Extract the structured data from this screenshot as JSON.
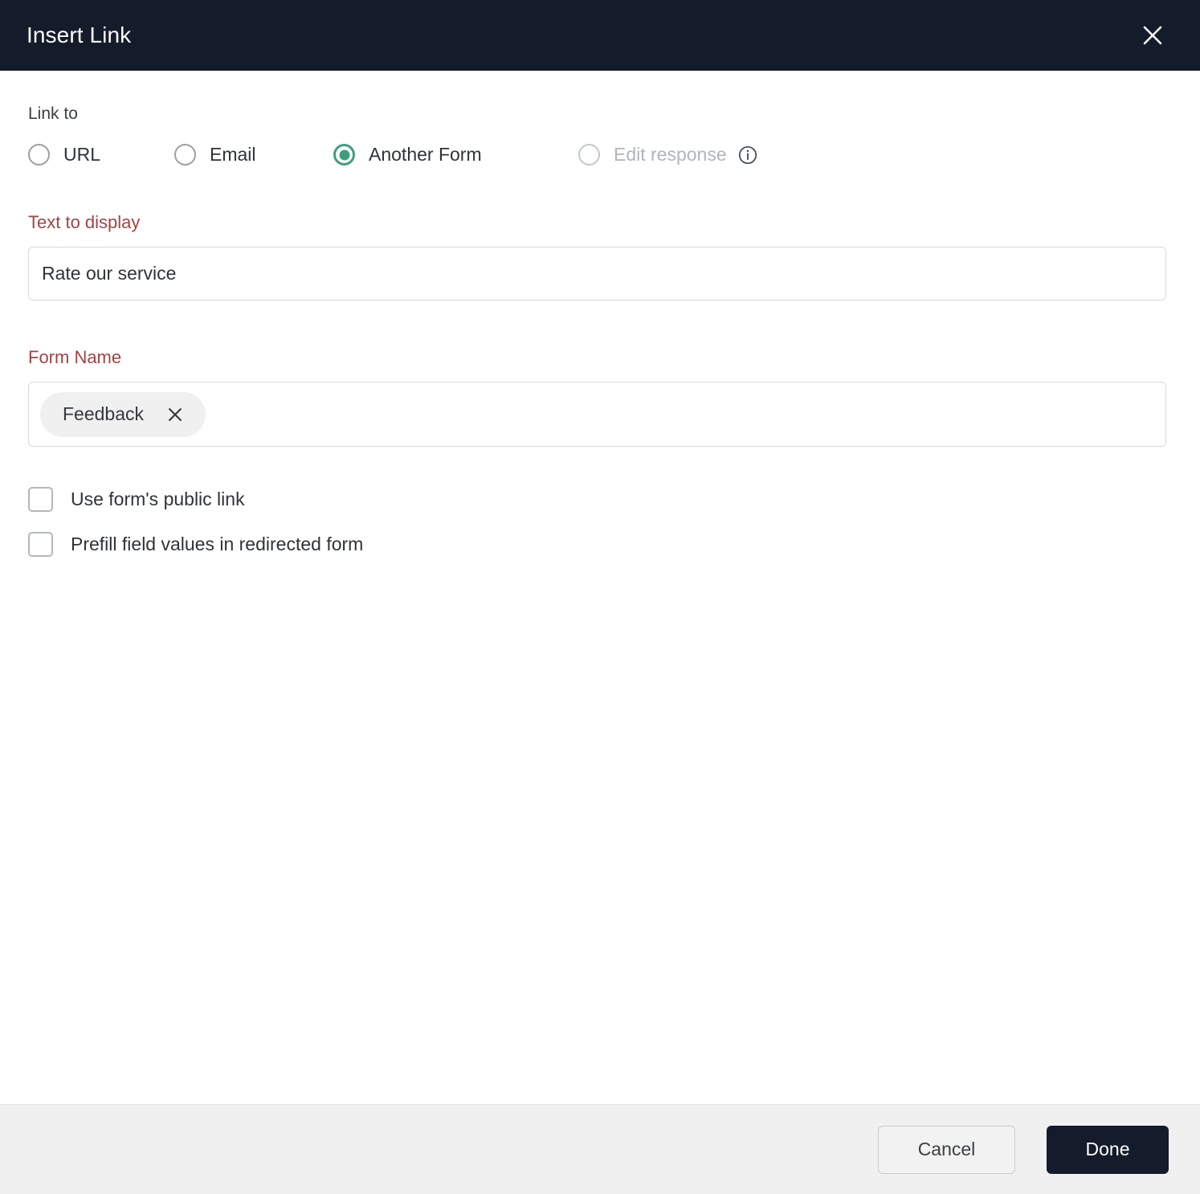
{
  "header": {
    "title": "Insert Link",
    "close_icon": "close-icon"
  },
  "link_to": {
    "label": "Link to",
    "options": [
      {
        "id": "url",
        "label": "URL",
        "selected": false,
        "disabled": false
      },
      {
        "id": "email",
        "label": "Email",
        "selected": false,
        "disabled": false
      },
      {
        "id": "another-form",
        "label": "Another Form",
        "selected": true,
        "disabled": false
      },
      {
        "id": "edit-response",
        "label": "Edit response",
        "selected": false,
        "disabled": true,
        "info_icon": "info-icon"
      }
    ],
    "selected": "Another Form"
  },
  "text_to_display": {
    "label": "Text to display",
    "value": "Rate our service",
    "placeholder": ""
  },
  "form_name": {
    "label": "Form Name",
    "chip": {
      "label": "Feedback",
      "remove_icon": "close-icon"
    }
  },
  "checkboxes": [
    {
      "id": "use-public-link",
      "label": "Use form's public link",
      "checked": false
    },
    {
      "id": "prefill-field-values",
      "label": "Prefill field values in redirected form",
      "checked": false
    }
  ],
  "footer": {
    "cancel_label": "Cancel",
    "done_label": "Done"
  },
  "colors": {
    "header_bg": "#141c2b",
    "accent_selected": "#3f9e7f",
    "required_label": "#a34343",
    "footer_bg": "#f0f0f0",
    "primary_button_bg": "#141c2b",
    "disabled_text": "#b0b5bb"
  }
}
